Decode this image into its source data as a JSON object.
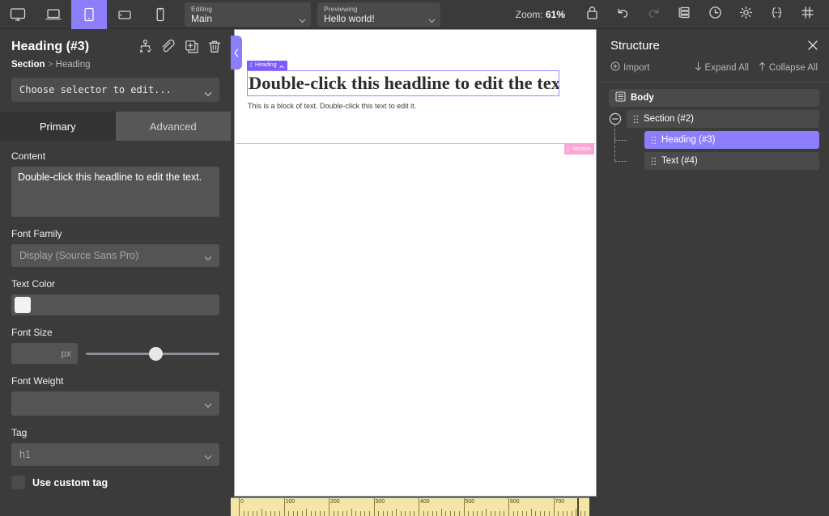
{
  "toolbar": {
    "devices": [
      {
        "name": "desktop",
        "icon": "monitor-icon",
        "active": false
      },
      {
        "name": "laptop",
        "icon": "laptop-icon",
        "active": false
      },
      {
        "name": "tablet-portrait",
        "icon": "tablet-portrait-icon",
        "active": true
      },
      {
        "name": "tablet-landscape",
        "icon": "tablet-landscape-icon",
        "active": false
      },
      {
        "name": "mobile",
        "icon": "mobile-icon",
        "active": false
      }
    ],
    "editing": {
      "label": "Editing",
      "value": "Main"
    },
    "previewing": {
      "label": "Previewing",
      "value": "Hello world!"
    },
    "zoom": {
      "prefix": "Zoom:",
      "value": "61%"
    },
    "actions": [
      {
        "name": "lock-icon",
        "disabled": false
      },
      {
        "name": "undo-icon",
        "disabled": false
      },
      {
        "name": "redo-icon",
        "disabled": true
      },
      {
        "name": "layers-icon",
        "disabled": false
      },
      {
        "name": "history-clock-icon",
        "disabled": false
      },
      {
        "name": "gear-icon",
        "disabled": false
      },
      {
        "name": "code-braces-icon",
        "disabled": false
      },
      {
        "name": "grid-hash-icon",
        "disabled": false
      }
    ]
  },
  "left_panel": {
    "title": "Heading (#3)",
    "breadcrumb": {
      "parent": "Section",
      "separator": ">",
      "current": "Heading"
    },
    "header_actions": [
      {
        "name": "move-node-icon"
      },
      {
        "name": "link-icon"
      },
      {
        "name": "duplicate-icon"
      },
      {
        "name": "delete-icon"
      }
    ],
    "selector_placeholder": "Choose selector to edit...",
    "tabs": [
      {
        "label": "Primary",
        "active": true
      },
      {
        "label": "Advanced",
        "active": false
      }
    ],
    "fields": {
      "content": {
        "label": "Content",
        "value": "Double-click this headline to edit the text."
      },
      "font_family": {
        "label": "Font Family",
        "value": "Display (Source Sans Pro)"
      },
      "text_color": {
        "label": "Text Color",
        "swatch": "#f2f2f2"
      },
      "font_size": {
        "label": "Font Size",
        "value": "",
        "unit": "px",
        "slider_percent": 47
      },
      "font_weight": {
        "label": "Font Weight",
        "value": ""
      },
      "tag": {
        "label": "Tag",
        "value": "h1"
      },
      "use_custom_tag": {
        "label": "Use custom tag",
        "checked": false
      }
    }
  },
  "canvas": {
    "collapse_handle": "collapse-left-panel-handle",
    "heading_badge": "Heading",
    "heading_text": "Double-click this headline to edit the text.",
    "paragraph_text": "This is a block of text. Double-click this text to edit it.",
    "section_badge": "Section",
    "ruler_labels": [
      "0",
      "100",
      "200",
      "300",
      "400",
      "500",
      "600",
      "700"
    ]
  },
  "right_panel": {
    "title": "Structure",
    "import_label": "Import",
    "expand_all_label": "Expand All",
    "collapse_all_label": "Collapse All",
    "tree": [
      {
        "label": "Body",
        "depth": 0,
        "selected": false,
        "icon": "body-icon"
      },
      {
        "label": "Section (#2)",
        "depth": 1,
        "selected": false,
        "collapsible": true
      },
      {
        "label": "Heading (#3)",
        "depth": 2,
        "selected": true
      },
      {
        "label": "Text (#4)",
        "depth": 2,
        "selected": false
      }
    ]
  },
  "colors": {
    "accent_purple": "#8c7dfa",
    "section_pink": "#fba5d4",
    "panel_bg": "#3b3b3b",
    "toolbar_bg": "#3a3a3a",
    "ruler_bg": "#f5e6a8"
  }
}
